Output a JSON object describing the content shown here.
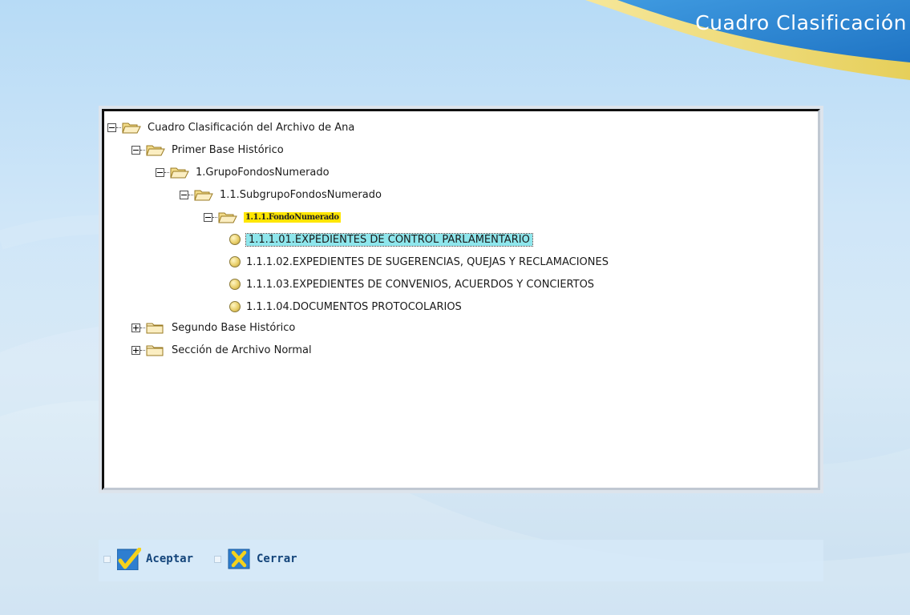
{
  "header": {
    "title": "Cuadro Clasificación"
  },
  "tree": [
    {
      "label": "Cuadro Clasificación del Archivo de Ana",
      "toggle": "minus",
      "icon": "folder-open-icon"
    },
    {
      "label": "Primer Base Histórico",
      "toggle": "minus",
      "icon": "folder-open-icon"
    },
    {
      "label": "1.GrupoFondosNumerado",
      "toggle": "minus",
      "icon": "folder-open-icon"
    },
    {
      "label": "1.1.SubgrupoFondosNumerado",
      "toggle": "minus",
      "icon": "folder-open-icon"
    },
    {
      "label": "1.1.1.FondoNumerado",
      "toggle": "minus",
      "icon": "folder-open-icon",
      "highlight": "#ffe600"
    },
    {
      "label": "1.1.1.01.EXPEDIENTES DE CONTROL PARLAMENTARIO",
      "icon": "leaf-circle-icon",
      "focused": true,
      "highlight": "#8ee6ec"
    },
    {
      "label": "1.1.1.02.EXPEDIENTES DE SUGERENCIAS, QUEJAS Y RECLAMACIONES",
      "icon": "leaf-circle-icon"
    },
    {
      "label": "1.1.1.03.EXPEDIENTES DE CONVENIOS, ACUERDOS Y CONCIERTOS",
      "icon": "leaf-circle-icon"
    },
    {
      "label": "1.1.1.04.DOCUMENTOS PROTOCOLARIOS",
      "icon": "leaf-circle-icon"
    },
    {
      "label": "Segundo Base Histórico",
      "toggle": "plus",
      "icon": "folder-closed-icon"
    },
    {
      "label": "Sección de Archivo Normal",
      "toggle": "plus",
      "icon": "folder-closed-icon"
    }
  ],
  "buttons": {
    "accept": {
      "label": "Aceptar",
      "icon": "checkmark-icon"
    },
    "close": {
      "label": "Cerrar",
      "icon": "x-close-icon"
    }
  },
  "colors": {
    "accent_blue": "#13447a",
    "selected_yellow": "#ffe600",
    "focused_cyan": "#8ee6ec"
  }
}
